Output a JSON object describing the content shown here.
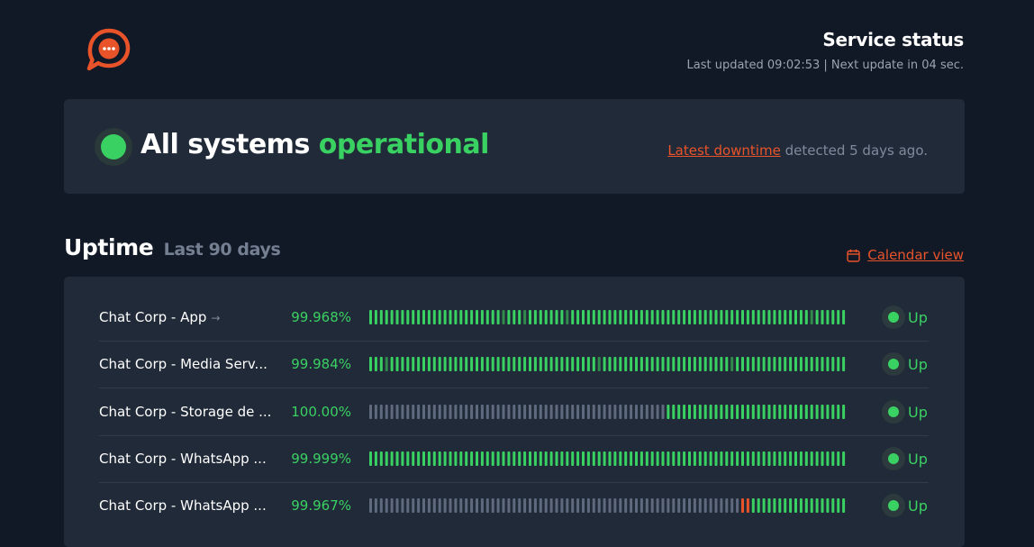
{
  "colors": {
    "up": "#3ad163",
    "up_dim": "#2f8a4c",
    "nodata": "#5f6a7f",
    "incident": "#e9532a",
    "accent": "#e9532a"
  },
  "header": {
    "logo_icon": "chat-bubble-logo",
    "title": "Service status",
    "last_updated": "Last updated 09:02:53 | Next update in 04 sec."
  },
  "banner": {
    "title_main": "All systems",
    "title_status": "operational",
    "downtime_link": "Latest downtime",
    "downtime_suffix": "detected 5 days ago."
  },
  "uptime": {
    "title": "Uptime",
    "subtitle": "Last 90 days",
    "calendar_icon": "calendar-icon",
    "calendar_link": "Calendar view"
  },
  "services": [
    {
      "name": "Chat Corp - App",
      "has_arrow": true,
      "arrow": "→",
      "uptime": "99.968%",
      "status": "Up",
      "bars": "gggggggggggggggggggggggggdgggdgggggggdgggggggggggggggggggggggggggggggggggggggggggggdgggggggg"
    },
    {
      "name": "Chat Corp - Media Serv...",
      "has_arrow": false,
      "uptime": "99.984%",
      "status": "Up",
      "bars": "gggdgggggggggggggggggggggggggggggggggggggggdggggggggggggggggggggggggdggggggggggggggggggggg"
    },
    {
      "name": "Chat Corp - Storage de ...",
      "has_arrow": false,
      "uptime": "100.00%",
      "status": "Up",
      "bars": "nnnnnnnnnnnnnnnnnnnnnnnnnnnnnnnnnnnnnnnnnnnnnnnnnnnnnnnnggggggggggggggggggggggggggggggggggg"
    },
    {
      "name": "Chat Corp - WhatsApp ...",
      "has_arrow": false,
      "uptime": "99.999%",
      "status": "Up",
      "bars": "ggggggggggggggggggggggggggggggggggggggggggggggggggggggggggggggggggggggggggggggggggggggggggg"
    },
    {
      "name": "Chat Corp - WhatsApp ...",
      "has_arrow": false,
      "uptime": "99.967%",
      "status": "Up",
      "bars": "nnnnnnnnnnnnnnnnnnnnnnnnnnnnnnnnnnnnnnnnnnnnnnnnnnnnnnnnnnnnnnnnnnnnnnoogggggggggggggggggg"
    }
  ]
}
